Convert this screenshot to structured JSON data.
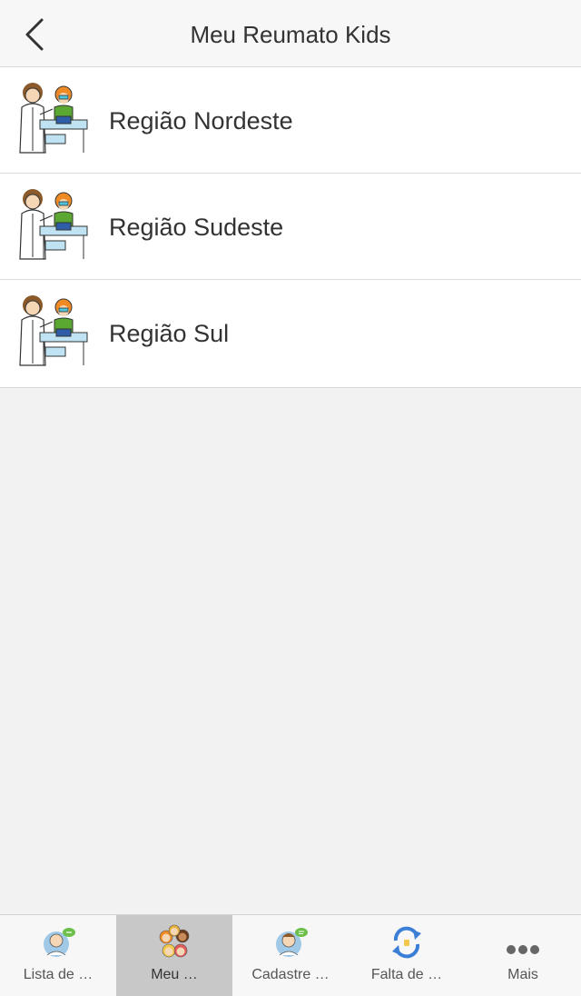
{
  "header": {
    "title": "Meu Reumato Kids",
    "back_icon": "chevron-left-icon"
  },
  "list": {
    "items": [
      {
        "label": "Região Nordeste",
        "icon": "doctor-child-icon"
      },
      {
        "label": "Região Sudeste",
        "icon": "doctor-child-icon"
      },
      {
        "label": "Região Sul",
        "icon": "doctor-child-icon"
      }
    ]
  },
  "tabbar": {
    "tabs": [
      {
        "label": "Lista de …",
        "icon": "doctor-chat-icon",
        "active": false
      },
      {
        "label": "Meu …",
        "icon": "kids-group-icon",
        "active": true
      },
      {
        "label": "Cadastre …",
        "icon": "register-icon",
        "active": false
      },
      {
        "label": "Falta de …",
        "icon": "refresh-icon",
        "active": false
      },
      {
        "label": "Mais",
        "icon": "more-icon",
        "active": false
      }
    ]
  },
  "colors": {
    "header_bg": "#f7f7f7",
    "page_bg": "#f2f2f2",
    "active_tab_bg": "#c8c8c8",
    "refresh_blue": "#3b7fd6"
  }
}
